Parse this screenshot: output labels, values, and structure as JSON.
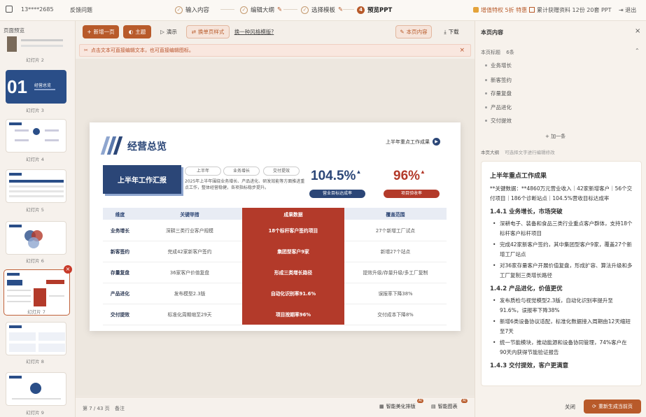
{
  "topbar": {
    "user": "13****2685",
    "feedback": "反馈问题",
    "steps": [
      "输入内容",
      "编辑大纲",
      "选择模板",
      "预览PPT"
    ],
    "step4_num": "4",
    "promo1": "增值特权 5折 特惠",
    "promo2": "累计获赠资料 12份 20套 PPT",
    "logout": "退出"
  },
  "left": {
    "title": "页面预览",
    "pages": [
      "幻灯片 2",
      "幻灯片 3",
      "幻灯片 4",
      "幻灯片 5",
      "幻灯片 6",
      "幻灯片 7",
      "幻灯片 8",
      "幻灯片 9"
    ],
    "thumb3_num": "01",
    "thumb3_title": "经营总览"
  },
  "toolbar": {
    "new_page": "新增一页",
    "theme": "主题",
    "present": "演示",
    "template_style": "换单页样式",
    "change_template": "换一种风格模版?",
    "page_content": "本页内容",
    "download": "下载"
  },
  "notice": "点击文本可直接编辑文本，也可直接编辑图标。",
  "slide": {
    "title": "经营总览",
    "link": "上半年重点工作成果",
    "banner": "上半年工作汇报",
    "pills": [
      "上半年",
      "业务增长",
      "交付提效"
    ],
    "desc": "2025年上半年围绕业务增长、产品进化、研发效能等方面推进重点工作，整体经营稳健，各项指标稳步提升。",
    "kpi1_value": "104.5%",
    "kpi1_label": "营业目标达成率",
    "kpi2_value": "96%",
    "kpi2_label": "项目验收率",
    "table": {
      "headers": [
        "维度",
        "关键举措",
        "成果数据",
        "覆盖范围"
      ],
      "rows": [
        [
          "业务增长",
          "深耕三类行业客户规模",
          "18个标杆客户签约项目",
          "27个新增工厂试点"
        ],
        [
          "新客签约",
          "完成42家新客户签约",
          "集团型客户9家",
          "新增27个站点"
        ],
        [
          "存量复盘",
          "36家客户价值复盘",
          "形成三类增长路径",
          "提效升级/存量升级/多工厂复制"
        ],
        [
          "产品进化",
          "发布模型2.3版",
          "自动化识别率91.6%",
          "误报率下降38%"
        ],
        [
          "交付提效",
          "标准化周期缩至29天",
          "项目按期率96%",
          "交付成本下降8%"
        ]
      ]
    }
  },
  "bottom": {
    "page_info": "第 7 / 43 页",
    "notes": "备注",
    "smart_layout": "智能美化排版",
    "smart_chart": "智能图表",
    "ai_badge": "AI"
  },
  "right": {
    "title": "本页内容",
    "section_title": "本页标题",
    "count": "6条",
    "items": [
      "业务增长",
      "新客签约",
      "存量复盘",
      "产品进化",
      "交付提效"
    ],
    "add": "+ 加一条",
    "notes_title": "本页大纲",
    "notes_hint": "可选择文字进行编辑修改",
    "notes_heading": "上半年重点工作成果",
    "notes_intro": "**关键数据：**4860万元营业收入｜42家新增客户｜56个交付项目｜186个诊断站点｜104.5%营收目标达成率",
    "h1": "1.4.1 业务增长，市场突破",
    "h1_items": [
      "深耕电子、装备和食品三类行业重点客户群体，支持18个标杆客户标杆项目",
      "完成42家新客户签约，其中集团型客户9家，覆盖27个新增工厂站点",
      "对36家存量客户开展价值复盘，形成扩容、算法升级和多工厂复制三类增长路径"
    ],
    "h2": "1.4.2 产品进化，价值更优",
    "h2_items": [
      "发布质检与视觉模型2.3版，自动化识别率提升至91.6%，误报率下降38%",
      "新增6类设备协议适配，标准化数据接入周期由12天缩短至7天",
      "统一节能模块，推动能源和设备协同管理，74%客户在90天内获得节能验证报告"
    ],
    "h3": "1.4.3 交付提效，客户更满意",
    "cancel": "关闭",
    "regenerate": "重新生成当前页"
  },
  "colors": {
    "accent": "#b85a2a",
    "navy": "#2b4677",
    "red": "#b33a2a"
  }
}
